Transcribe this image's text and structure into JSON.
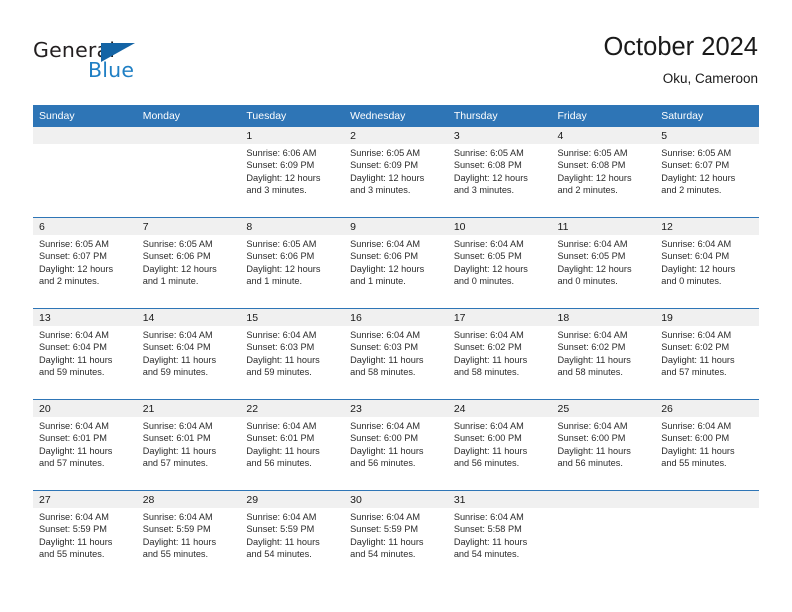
{
  "brand": {
    "name_part1": "General",
    "name_part2": "Blue",
    "accent_color": "#1f7fc4",
    "triangle_color": "#1464a5",
    "logo_icon": "triangle-flag-icon"
  },
  "header": {
    "title": "October 2024",
    "subtitle": "Oku, Cameroon"
  },
  "theme": {
    "header_row_bg": "#2e75b6",
    "date_band_bg": "#f0f0f0",
    "row_divider": "#2e75b6"
  },
  "weekdays": [
    "Sunday",
    "Monday",
    "Tuesday",
    "Wednesday",
    "Thursday",
    "Friday",
    "Saturday"
  ],
  "weeks": [
    [
      {
        "day": "",
        "empty": true
      },
      {
        "day": "",
        "empty": true
      },
      {
        "day": "1",
        "sunrise": "Sunrise: 6:06 AM",
        "sunset": "Sunset: 6:09 PM",
        "daylight": "Daylight: 12 hours and 3 minutes."
      },
      {
        "day": "2",
        "sunrise": "Sunrise: 6:05 AM",
        "sunset": "Sunset: 6:09 PM",
        "daylight": "Daylight: 12 hours and 3 minutes."
      },
      {
        "day": "3",
        "sunrise": "Sunrise: 6:05 AM",
        "sunset": "Sunset: 6:08 PM",
        "daylight": "Daylight: 12 hours and 3 minutes."
      },
      {
        "day": "4",
        "sunrise": "Sunrise: 6:05 AM",
        "sunset": "Sunset: 6:08 PM",
        "daylight": "Daylight: 12 hours and 2 minutes."
      },
      {
        "day": "5",
        "sunrise": "Sunrise: 6:05 AM",
        "sunset": "Sunset: 6:07 PM",
        "daylight": "Daylight: 12 hours and 2 minutes."
      }
    ],
    [
      {
        "day": "6",
        "sunrise": "Sunrise: 6:05 AM",
        "sunset": "Sunset: 6:07 PM",
        "daylight": "Daylight: 12 hours and 2 minutes."
      },
      {
        "day": "7",
        "sunrise": "Sunrise: 6:05 AM",
        "sunset": "Sunset: 6:06 PM",
        "daylight": "Daylight: 12 hours and 1 minute."
      },
      {
        "day": "8",
        "sunrise": "Sunrise: 6:05 AM",
        "sunset": "Sunset: 6:06 PM",
        "daylight": "Daylight: 12 hours and 1 minute."
      },
      {
        "day": "9",
        "sunrise": "Sunrise: 6:04 AM",
        "sunset": "Sunset: 6:06 PM",
        "daylight": "Daylight: 12 hours and 1 minute."
      },
      {
        "day": "10",
        "sunrise": "Sunrise: 6:04 AM",
        "sunset": "Sunset: 6:05 PM",
        "daylight": "Daylight: 12 hours and 0 minutes."
      },
      {
        "day": "11",
        "sunrise": "Sunrise: 6:04 AM",
        "sunset": "Sunset: 6:05 PM",
        "daylight": "Daylight: 12 hours and 0 minutes."
      },
      {
        "day": "12",
        "sunrise": "Sunrise: 6:04 AM",
        "sunset": "Sunset: 6:04 PM",
        "daylight": "Daylight: 12 hours and 0 minutes."
      }
    ],
    [
      {
        "day": "13",
        "sunrise": "Sunrise: 6:04 AM",
        "sunset": "Sunset: 6:04 PM",
        "daylight": "Daylight: 11 hours and 59 minutes."
      },
      {
        "day": "14",
        "sunrise": "Sunrise: 6:04 AM",
        "sunset": "Sunset: 6:04 PM",
        "daylight": "Daylight: 11 hours and 59 minutes."
      },
      {
        "day": "15",
        "sunrise": "Sunrise: 6:04 AM",
        "sunset": "Sunset: 6:03 PM",
        "daylight": "Daylight: 11 hours and 59 minutes."
      },
      {
        "day": "16",
        "sunrise": "Sunrise: 6:04 AM",
        "sunset": "Sunset: 6:03 PM",
        "daylight": "Daylight: 11 hours and 58 minutes."
      },
      {
        "day": "17",
        "sunrise": "Sunrise: 6:04 AM",
        "sunset": "Sunset: 6:02 PM",
        "daylight": "Daylight: 11 hours and 58 minutes."
      },
      {
        "day": "18",
        "sunrise": "Sunrise: 6:04 AM",
        "sunset": "Sunset: 6:02 PM",
        "daylight": "Daylight: 11 hours and 58 minutes."
      },
      {
        "day": "19",
        "sunrise": "Sunrise: 6:04 AM",
        "sunset": "Sunset: 6:02 PM",
        "daylight": "Daylight: 11 hours and 57 minutes."
      }
    ],
    [
      {
        "day": "20",
        "sunrise": "Sunrise: 6:04 AM",
        "sunset": "Sunset: 6:01 PM",
        "daylight": "Daylight: 11 hours and 57 minutes."
      },
      {
        "day": "21",
        "sunrise": "Sunrise: 6:04 AM",
        "sunset": "Sunset: 6:01 PM",
        "daylight": "Daylight: 11 hours and 57 minutes."
      },
      {
        "day": "22",
        "sunrise": "Sunrise: 6:04 AM",
        "sunset": "Sunset: 6:01 PM",
        "daylight": "Daylight: 11 hours and 56 minutes."
      },
      {
        "day": "23",
        "sunrise": "Sunrise: 6:04 AM",
        "sunset": "Sunset: 6:00 PM",
        "daylight": "Daylight: 11 hours and 56 minutes."
      },
      {
        "day": "24",
        "sunrise": "Sunrise: 6:04 AM",
        "sunset": "Sunset: 6:00 PM",
        "daylight": "Daylight: 11 hours and 56 minutes."
      },
      {
        "day": "25",
        "sunrise": "Sunrise: 6:04 AM",
        "sunset": "Sunset: 6:00 PM",
        "daylight": "Daylight: 11 hours and 56 minutes."
      },
      {
        "day": "26",
        "sunrise": "Sunrise: 6:04 AM",
        "sunset": "Sunset: 6:00 PM",
        "daylight": "Daylight: 11 hours and 55 minutes."
      }
    ],
    [
      {
        "day": "27",
        "sunrise": "Sunrise: 6:04 AM",
        "sunset": "Sunset: 5:59 PM",
        "daylight": "Daylight: 11 hours and 55 minutes."
      },
      {
        "day": "28",
        "sunrise": "Sunrise: 6:04 AM",
        "sunset": "Sunset: 5:59 PM",
        "daylight": "Daylight: 11 hours and 55 minutes."
      },
      {
        "day": "29",
        "sunrise": "Sunrise: 6:04 AM",
        "sunset": "Sunset: 5:59 PM",
        "daylight": "Daylight: 11 hours and 54 minutes."
      },
      {
        "day": "30",
        "sunrise": "Sunrise: 6:04 AM",
        "sunset": "Sunset: 5:59 PM",
        "daylight": "Daylight: 11 hours and 54 minutes."
      },
      {
        "day": "31",
        "sunrise": "Sunrise: 6:04 AM",
        "sunset": "Sunset: 5:58 PM",
        "daylight": "Daylight: 11 hours and 54 minutes."
      },
      {
        "day": "",
        "empty": true
      },
      {
        "day": "",
        "empty": true
      }
    ]
  ]
}
